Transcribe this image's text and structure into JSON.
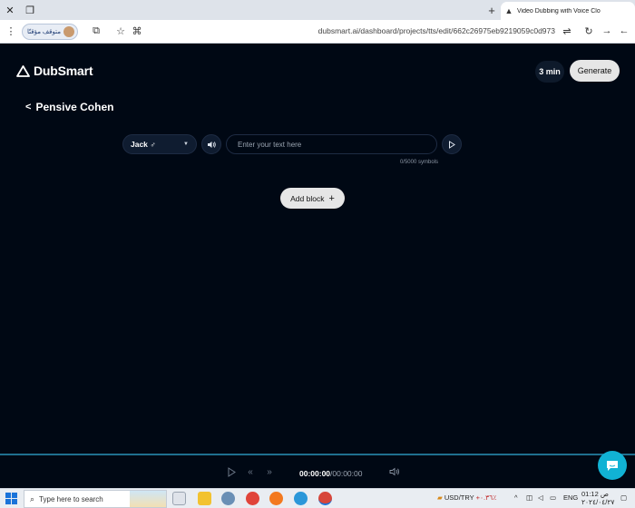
{
  "browser": {
    "tab_title": "Video Dubbing with Voice Clo",
    "url": "dubsmart.ai/dashboard/projects/tts/edit/662c26975eb9219059c0d973",
    "profile_label": "متوقف مؤقتًا"
  },
  "app": {
    "logo_text": "DubSmart",
    "credits": "3 min",
    "generate_label": "Generate",
    "project_title": "Pensive Cohen",
    "block": {
      "voice": "Jack ♂",
      "text_placeholder": "Enter your text here",
      "counter": "0/5000 symbols"
    },
    "add_block_label": "Add block",
    "player": {
      "current_time": "00:00:00",
      "duration": "/00:00:00"
    }
  },
  "taskbar": {
    "search_placeholder": "Type here to search",
    "ticker": "USD/TRY",
    "ticker_change": "+٠.٣٦٪",
    "language": "ENG",
    "time": "01:12 ص",
    "date": "٢٠٢٤/٠٤/٢٧"
  }
}
